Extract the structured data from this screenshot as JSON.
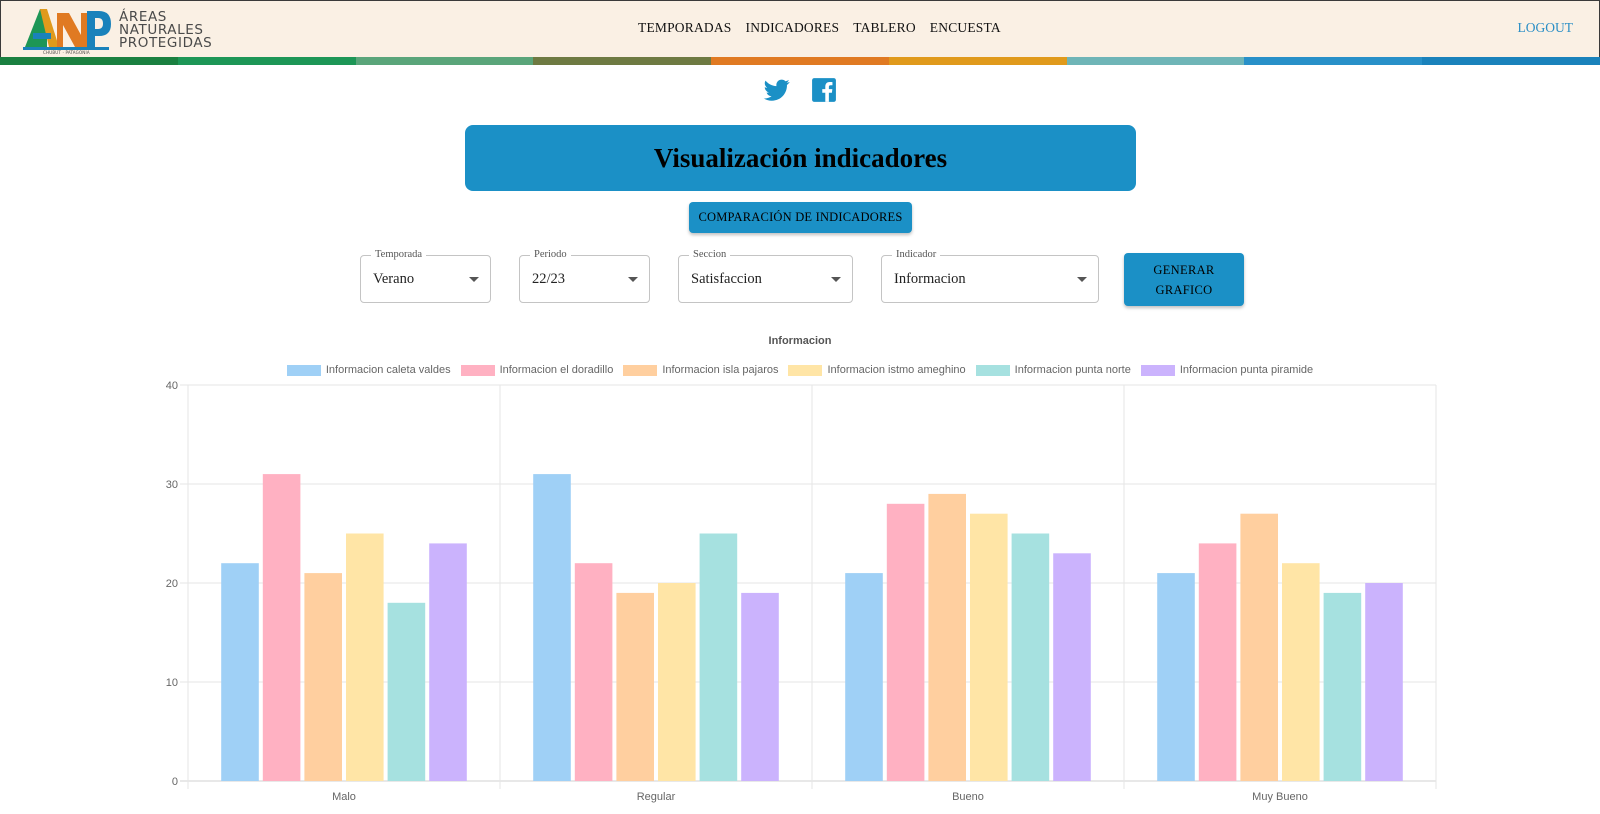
{
  "header": {
    "logo_letters": "ANP",
    "logo_lines": [
      "ÁREAS",
      "NATURALES",
      "PROTEGIDAS"
    ],
    "logo_tagline": "CHUBUT · PATAGONIA",
    "nav": [
      "TEMPORADAS",
      "INDICADORES",
      "TABLERO",
      "ENCUESTA"
    ],
    "logout": "LOGOUT",
    "stripe_colors": [
      "#1a8040",
      "#1d9656",
      "#5aa57a",
      "#6e7a42",
      "#e07a22",
      "#e09a1c",
      "#6fb5b7",
      "#2890c8",
      "#1a82bb"
    ]
  },
  "social": {
    "icons": [
      "twitter-icon",
      "facebook-icon"
    ],
    "color": "#1b90c6"
  },
  "page": {
    "title": "Visualización indicadores",
    "compare_button": "COMPARACIÓN DE INDICADORES",
    "generate_button": [
      "GENERAR",
      "GRAFICO"
    ]
  },
  "filters": {
    "temporada": {
      "label": "Temporada",
      "value": "Verano"
    },
    "periodo": {
      "label": "Periodo",
      "value": "22/23"
    },
    "seccion": {
      "label": "Seccion",
      "value": "Satisfaccion"
    },
    "indicador": {
      "label": "Indicador",
      "value": "Informacion"
    }
  },
  "chart_data": {
    "type": "bar",
    "title": "Informacion",
    "categories": [
      "Malo",
      "Regular",
      "Bueno",
      "Muy Bueno"
    ],
    "ylim": [
      0,
      40
    ],
    "yticks": [
      0,
      10,
      20,
      30,
      40
    ],
    "grid": true,
    "legend_position": "top",
    "series": [
      {
        "name": "Informacion caleta valdes",
        "values": [
          22,
          31,
          21,
          21
        ],
        "color": "#9fd0f6"
      },
      {
        "name": "Informacion el doradillo",
        "values": [
          31,
          22,
          28,
          24
        ],
        "color": "#ffb1c2"
      },
      {
        "name": "Informacion isla pajaros",
        "values": [
          21,
          19,
          29,
          27
        ],
        "color": "#ffcf9f"
      },
      {
        "name": "Informacion istmo ameghino",
        "values": [
          25,
          20,
          27,
          22
        ],
        "color": "#ffe5a6"
      },
      {
        "name": "Informacion punta norte",
        "values": [
          18,
          25,
          25,
          19
        ],
        "color": "#a6e1e0"
      },
      {
        "name": "Informacion punta piramide",
        "values": [
          24,
          19,
          23,
          20
        ],
        "color": "#cbb3fd"
      }
    ]
  }
}
